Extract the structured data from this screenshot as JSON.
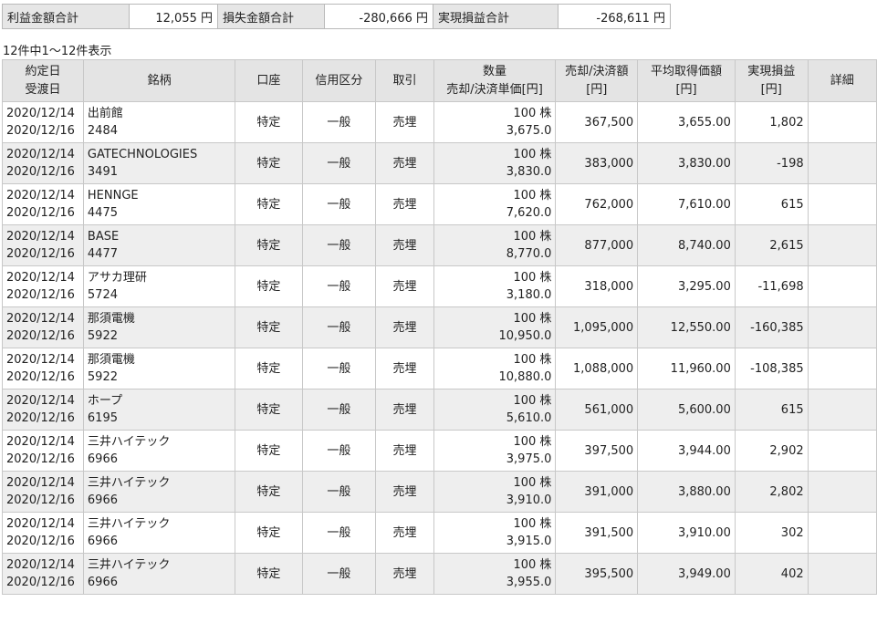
{
  "summary": {
    "profit_label": "利益金額合計",
    "profit_value": "12,055 円",
    "loss_label": "損失金額合計",
    "loss_value": "-280,666 円",
    "realized_label": "実現損益合計",
    "realized_value": "-268,611 円"
  },
  "count_text": "12件中1～12件表示",
  "headers": {
    "date1": "約定日",
    "date2": "受渡日",
    "name": "銘柄",
    "account": "口座",
    "credit": "信用区分",
    "trade": "取引",
    "qty1": "数量",
    "qty2": "売却/決済単価[円]",
    "amount1": "売却/決済額",
    "amount2": "[円]",
    "avg1": "平均取得価額",
    "avg2": "[円]",
    "pl1": "実現損益",
    "pl2": "[円]",
    "detail": "詳細"
  },
  "rows": [
    {
      "date1": "2020/12/14",
      "date2": "2020/12/16",
      "name": "出前館",
      "code": "2484",
      "account": "特定",
      "credit": "一般",
      "trade": "売埋",
      "qty": "100 株",
      "price": "3,675.0",
      "amount": "367,500",
      "avg": "3,655.00",
      "pl": "1,802"
    },
    {
      "date1": "2020/12/14",
      "date2": "2020/12/16",
      "name": "GATECHNOLOGIES",
      "code": "3491",
      "account": "特定",
      "credit": "一般",
      "trade": "売埋",
      "qty": "100 株",
      "price": "3,830.0",
      "amount": "383,000",
      "avg": "3,830.00",
      "pl": "-198"
    },
    {
      "date1": "2020/12/14",
      "date2": "2020/12/16",
      "name": "HENNGE",
      "code": "4475",
      "account": "特定",
      "credit": "一般",
      "trade": "売埋",
      "qty": "100 株",
      "price": "7,620.0",
      "amount": "762,000",
      "avg": "7,610.00",
      "pl": "615"
    },
    {
      "date1": "2020/12/14",
      "date2": "2020/12/16",
      "name": "BASE",
      "code": "4477",
      "account": "特定",
      "credit": "一般",
      "trade": "売埋",
      "qty": "100 株",
      "price": "8,770.0",
      "amount": "877,000",
      "avg": "8,740.00",
      "pl": "2,615"
    },
    {
      "date1": "2020/12/14",
      "date2": "2020/12/16",
      "name": "アサカ理研",
      "code": "5724",
      "account": "特定",
      "credit": "一般",
      "trade": "売埋",
      "qty": "100 株",
      "price": "3,180.0",
      "amount": "318,000",
      "avg": "3,295.00",
      "pl": "-11,698"
    },
    {
      "date1": "2020/12/14",
      "date2": "2020/12/16",
      "name": "那須電機",
      "code": "5922",
      "account": "特定",
      "credit": "一般",
      "trade": "売埋",
      "qty": "100 株",
      "price": "10,950.0",
      "amount": "1,095,000",
      "avg": "12,550.00",
      "pl": "-160,385"
    },
    {
      "date1": "2020/12/14",
      "date2": "2020/12/16",
      "name": "那須電機",
      "code": "5922",
      "account": "特定",
      "credit": "一般",
      "trade": "売埋",
      "qty": "100 株",
      "price": "10,880.0",
      "amount": "1,088,000",
      "avg": "11,960.00",
      "pl": "-108,385"
    },
    {
      "date1": "2020/12/14",
      "date2": "2020/12/16",
      "name": "ホープ",
      "code": "6195",
      "account": "特定",
      "credit": "一般",
      "trade": "売埋",
      "qty": "100 株",
      "price": "5,610.0",
      "amount": "561,000",
      "avg": "5,600.00",
      "pl": "615"
    },
    {
      "date1": "2020/12/14",
      "date2": "2020/12/16",
      "name": "三井ハイテック",
      "code": "6966",
      "account": "特定",
      "credit": "一般",
      "trade": "売埋",
      "qty": "100 株",
      "price": "3,975.0",
      "amount": "397,500",
      "avg": "3,944.00",
      "pl": "2,902"
    },
    {
      "date1": "2020/12/14",
      "date2": "2020/12/16",
      "name": "三井ハイテック",
      "code": "6966",
      "account": "特定",
      "credit": "一般",
      "trade": "売埋",
      "qty": "100 株",
      "price": "3,910.0",
      "amount": "391,000",
      "avg": "3,880.00",
      "pl": "2,802"
    },
    {
      "date1": "2020/12/14",
      "date2": "2020/12/16",
      "name": "三井ハイテック",
      "code": "6966",
      "account": "特定",
      "credit": "一般",
      "trade": "売埋",
      "qty": "100 株",
      "price": "3,915.0",
      "amount": "391,500",
      "avg": "3,910.00",
      "pl": "302"
    },
    {
      "date1": "2020/12/14",
      "date2": "2020/12/16",
      "name": "三井ハイテック",
      "code": "6966",
      "account": "特定",
      "credit": "一般",
      "trade": "売埋",
      "qty": "100 株",
      "price": "3,955.0",
      "amount": "395,500",
      "avg": "3,949.00",
      "pl": "402"
    }
  ]
}
